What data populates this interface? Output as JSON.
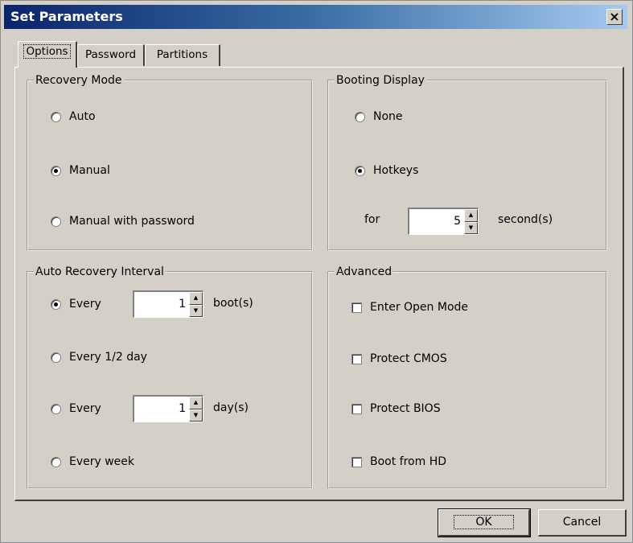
{
  "window": {
    "title": "Set Parameters",
    "close_label": "×"
  },
  "tabs": [
    {
      "label": "Options",
      "active": true
    },
    {
      "label": "Password",
      "active": false
    },
    {
      "label": "Partitions",
      "active": false
    }
  ],
  "recovery_mode": {
    "title": "Recovery Mode",
    "options": [
      {
        "label": "Auto",
        "checked": false
      },
      {
        "label": "Manual",
        "checked": true
      },
      {
        "label": "Manual with password",
        "checked": false
      }
    ]
  },
  "booting_display": {
    "title": "Booting Display",
    "options": [
      {
        "label": "None",
        "checked": false
      },
      {
        "label": "Hotkeys",
        "checked": true
      }
    ],
    "for_label": "for",
    "seconds_value": "5",
    "seconds_unit": "second(s)"
  },
  "auto_recovery_interval": {
    "title": "Auto Recovery Interval",
    "every_boot": {
      "label": "Every",
      "value": "1",
      "unit": "boot(s)",
      "checked": true
    },
    "every_half_day": {
      "label": "Every 1/2 day",
      "checked": false
    },
    "every_day": {
      "label": "Every",
      "value": "1",
      "unit": "day(s)",
      "checked": false
    },
    "every_week": {
      "label": "Every week",
      "checked": false
    }
  },
  "advanced": {
    "title": "Advanced",
    "options": [
      {
        "label": "Enter Open Mode",
        "checked": false
      },
      {
        "label": "Protect CMOS",
        "checked": false
      },
      {
        "label": "Protect BIOS",
        "checked": false
      },
      {
        "label": "Boot from HD",
        "checked": false
      }
    ]
  },
  "buttons": {
    "ok": "OK",
    "cancel": "Cancel"
  },
  "spinner_glyphs": {
    "up": "▲",
    "down": "▼"
  },
  "colors": {
    "face": "#d4d0c8",
    "titlebar_start": "#0a246a",
    "titlebar_end": "#a6caf0"
  }
}
